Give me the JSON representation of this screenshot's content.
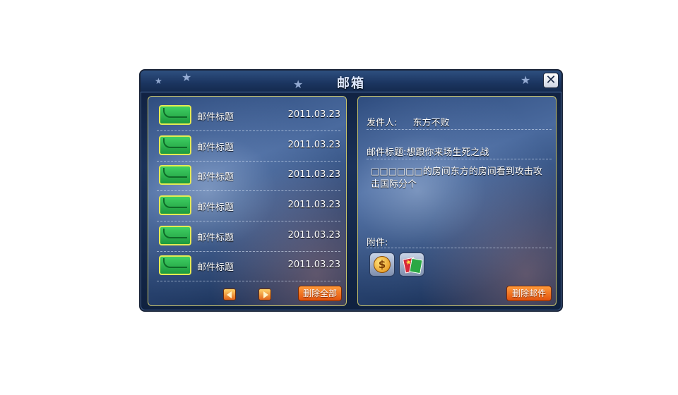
{
  "window": {
    "title": "邮箱",
    "close_glyph": "✕"
  },
  "mail_list": {
    "items": [
      {
        "subject": "邮件标题",
        "date": "2011.03.23"
      },
      {
        "subject": "邮件标题",
        "date": "2011.03.23"
      },
      {
        "subject": "邮件标题",
        "date": "2011.03.23"
      },
      {
        "subject": "邮件标题",
        "date": "2011.03.23"
      },
      {
        "subject": "邮件标题",
        "date": "2011.03.23"
      },
      {
        "subject": "邮件标题",
        "date": "2011.03.23"
      }
    ],
    "delete_all_label": "删除全部"
  },
  "mail_detail": {
    "sender_label": "发件人:",
    "sender_value": "东方不败",
    "subject_label": "邮件标题:",
    "subject_value": "想跟你来场生死之战",
    "body": "□□□□□□的房间东方的房间看到攻击攻击国际分个",
    "attachments_label": "附件:",
    "coin_glyph": "$",
    "delete_label": "删除邮件"
  },
  "icons": {
    "envelope": "envelope-icon",
    "prev": "arrow-left-icon",
    "next": "arrow-right-icon",
    "coin": "gold-coin-icon",
    "cards": "card-pack-icon",
    "close": "close-icon"
  },
  "colors": {
    "frame": "#1a2438",
    "panel_border": "#c9c46b",
    "button_orange": "#e3520e",
    "envelope_green": "#1e9a3e"
  }
}
